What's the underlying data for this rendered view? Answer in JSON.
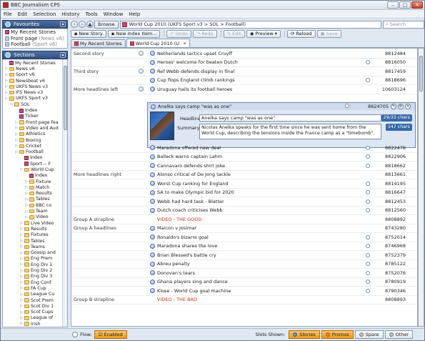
{
  "window": {
    "title": "BBC Journalism CPS"
  },
  "menu": [
    "File",
    "Edit",
    "Selection",
    "History",
    "Tools",
    "Window",
    "Help"
  ],
  "favourites": {
    "header": "Favourites",
    "items": [
      {
        "label": "My Recent Stories",
        "extra": ""
      },
      {
        "label": "Front page",
        "extra": "(News v6)"
      },
      {
        "label": "Football",
        "extra": "(Sport v6)"
      }
    ]
  },
  "sections": {
    "header": "Sections",
    "tree": [
      {
        "label": "My Recent Stories",
        "depth": 0,
        "kind": "page"
      },
      {
        "label": "News v6",
        "depth": 0,
        "kind": "folder"
      },
      {
        "label": "Sport v6",
        "depth": 0,
        "kind": "folder"
      },
      {
        "label": "Newsbeat v6",
        "depth": 0,
        "kind": "folder"
      },
      {
        "label": "UKFS News v3",
        "depth": 0,
        "kind": "folder"
      },
      {
        "label": "IFS News v3",
        "depth": 0,
        "kind": "folder"
      },
      {
        "label": "UKFS Sport v3",
        "depth": 0,
        "kind": "folder"
      },
      {
        "label": "SOL",
        "depth": 1,
        "kind": "folder"
      },
      {
        "label": "Index",
        "depth": 2,
        "kind": "page"
      },
      {
        "label": "Ticker",
        "depth": 2,
        "kind": "page"
      },
      {
        "label": "Front page fea",
        "depth": 2,
        "kind": "folder"
      },
      {
        "label": "Video and Aud",
        "depth": 2,
        "kind": "folder"
      },
      {
        "label": "Athletics",
        "depth": 2,
        "kind": "folder"
      },
      {
        "label": "Boxing",
        "depth": 2,
        "kind": "folder"
      },
      {
        "label": "Cricket",
        "depth": 2,
        "kind": "folder"
      },
      {
        "label": "Football",
        "depth": 2,
        "kind": "folder"
      },
      {
        "label": "Index",
        "depth": 3,
        "kind": "page"
      },
      {
        "label": "Sport -- F",
        "depth": 3,
        "kind": "page"
      },
      {
        "label": "World Cup",
        "depth": 3,
        "kind": "folder"
      },
      {
        "label": "Index",
        "depth": 4,
        "kind": "page"
      },
      {
        "label": "Fixture",
        "depth": 4,
        "kind": "folder"
      },
      {
        "label": "Match",
        "depth": 4,
        "kind": "folder"
      },
      {
        "label": "Results",
        "depth": 4,
        "kind": "folder"
      },
      {
        "label": "Tables",
        "depth": 4,
        "kind": "folder"
      },
      {
        "label": "BBC co",
        "depth": 4,
        "kind": "folder"
      },
      {
        "label": "Team",
        "depth": 4,
        "kind": "folder"
      },
      {
        "label": "Video",
        "depth": 4,
        "kind": "folder"
      },
      {
        "label": "Live Video",
        "depth": 3,
        "kind": "folder"
      },
      {
        "label": "Results",
        "depth": 3,
        "kind": "folder"
      },
      {
        "label": "Fixtures",
        "depth": 3,
        "kind": "folder"
      },
      {
        "label": "Tables",
        "depth": 3,
        "kind": "folder"
      },
      {
        "label": "Teams",
        "depth": 3,
        "kind": "folder"
      },
      {
        "label": "Gossip and",
        "depth": 3,
        "kind": "folder"
      },
      {
        "label": "Eng Prem",
        "depth": 3,
        "kind": "folder"
      },
      {
        "label": "Eng Div 1",
        "depth": 3,
        "kind": "folder"
      },
      {
        "label": "Eng Div 2",
        "depth": 3,
        "kind": "folder"
      },
      {
        "label": "Eng Div 3",
        "depth": 3,
        "kind": "folder"
      },
      {
        "label": "Eng Conf",
        "depth": 3,
        "kind": "folder"
      },
      {
        "label": "FA Cup",
        "depth": 3,
        "kind": "folder"
      },
      {
        "label": "League Cu",
        "depth": 3,
        "kind": "folder"
      },
      {
        "label": "Scot Prem",
        "depth": 3,
        "kind": "folder"
      },
      {
        "label": "Scot Div 1",
        "depth": 3,
        "kind": "folder"
      },
      {
        "label": "Scot Cups",
        "depth": 3,
        "kind": "folder"
      },
      {
        "label": "League of",
        "depth": 3,
        "kind": "folder"
      },
      {
        "label": "Irish",
        "depth": 3,
        "kind": "folder"
      }
    ]
  },
  "toolbar1": {
    "browse": "Browse",
    "address": "World Cup 2010 (UKFS Sport v3 > SOL > Football)",
    "search_placeholder": "Search"
  },
  "toolbar2": {
    "new_story": "New Story",
    "new_index": "New Index Item...",
    "undo": "Undo",
    "redo": "Redo",
    "edit": "Edit",
    "preview": "Preview",
    "reload": "Reload",
    "save": "Save"
  },
  "tabs": [
    {
      "label": "My Recent Stories",
      "active": false
    },
    {
      "label": "World Cup 2010 (U",
      "active": true
    }
  ],
  "rows_top": [
    {
      "slot": "Second story",
      "group_icon": true,
      "title": "Netherlands tactics upset Cruyff",
      "id": "8812484",
      "video": false
    },
    {
      "slot": "",
      "group_icon": false,
      "title": "Heroes' welcome for beaten Dutch",
      "id": "8816050",
      "video": false
    },
    {
      "slot": "Third story",
      "group_icon": true,
      "title": "Ref Webb defends display in final",
      "id": "8817459",
      "video": false
    },
    {
      "slot": "",
      "group_icon": false,
      "title": "Cup flops England climb rankings",
      "id": "8818696",
      "video": false
    },
    {
      "slot": "More headlines left",
      "group_icon": true,
      "title": "Uruguay hails its football heroes",
      "id": "10603124",
      "video": false
    }
  ],
  "editor": {
    "title": "Anelka says camp \"was as one\"",
    "id": "8824705",
    "headline_label": "Headline:",
    "headline_value": "Anelka says camp \"was as one\"",
    "headline_count": "29/33 chars",
    "summary_label": "Summary:",
    "summary_value": "Nicolas Anelka speaks for the first time since he was sent home from the World Cup, describing the tensions inside the France camp as a \"timebomb\".",
    "summary_count": "147 chars"
  },
  "rows_bottom": [
    {
      "slot": "",
      "group_icon": false,
      "title": "Maradona offered new deal",
      "id": "8822478",
      "video": false
    },
    {
      "slot": "",
      "group_icon": false,
      "title": "Ballack warns captain Lahm",
      "id": "8822906",
      "video": false
    },
    {
      "slot": "",
      "group_icon": false,
      "title": "Cannavaro defends shirt joke",
      "id": "8818662",
      "video": false
    },
    {
      "slot": "More headlines right",
      "group_icon": false,
      "title": "Alonso critical of De Jong tackle",
      "id": "8813661",
      "video": false
    },
    {
      "slot": "",
      "group_icon": false,
      "title": "Worst Cup ranking for England",
      "id": "8814195",
      "video": false
    },
    {
      "slot": "",
      "group_icon": false,
      "title": "SA to make Olympic bid for 2020",
      "id": "8816647",
      "video": false
    },
    {
      "slot": "",
      "group_icon": false,
      "title": "Webb had hard task - Blatter",
      "id": "8812453",
      "video": false
    },
    {
      "slot": "",
      "group_icon": false,
      "title": "Dutch coach criticises Webb",
      "id": "8812560",
      "video": false
    },
    {
      "slot": "Group A strapline",
      "group_icon": false,
      "title": "VIDEO - THE GOOD",
      "id": "8808892",
      "video": true
    },
    {
      "slot": "Group A headlines",
      "group_icon": false,
      "title": "Maicon v Josimar",
      "id": "8743280",
      "video": false
    },
    {
      "slot": "",
      "group_icon": false,
      "title": "Ronaldo's bizarre goal",
      "id": "8752014",
      "video": false
    },
    {
      "slot": "",
      "group_icon": false,
      "title": "Maradona shares the love",
      "id": "8746968",
      "video": false
    },
    {
      "slot": "",
      "group_icon": false,
      "title": "Brian Blessed's battle cry",
      "id": "8752379",
      "video": false
    },
    {
      "slot": "",
      "group_icon": false,
      "title": "Abreu penalty",
      "id": "8785122",
      "video": false
    },
    {
      "slot": "",
      "group_icon": false,
      "title": "Donovan's tears",
      "id": "8752076",
      "video": false
    },
    {
      "slot": "",
      "group_icon": false,
      "title": "Ghana players sing and dance",
      "id": "8780919",
      "video": false
    },
    {
      "slot": "",
      "group_icon": false,
      "title": "Klose - World Cup goal machine",
      "id": "8790346",
      "video": false
    },
    {
      "slot": "Group B strapline",
      "group_icon": false,
      "title": "VIDEO - THE BAD",
      "id": "8808893",
      "video": true
    }
  ],
  "statusbar": {
    "flow_label": "Flow:",
    "enabled": "Enabled",
    "slots_shown": "Slots Shown:",
    "stories": "Stories",
    "promos": "Promos",
    "spare": "Spare",
    "other": "Other"
  },
  "colors": {
    "accent": "#ef9b1f",
    "video_red": "#c4321d",
    "header_blue": "#2f4f7f"
  }
}
